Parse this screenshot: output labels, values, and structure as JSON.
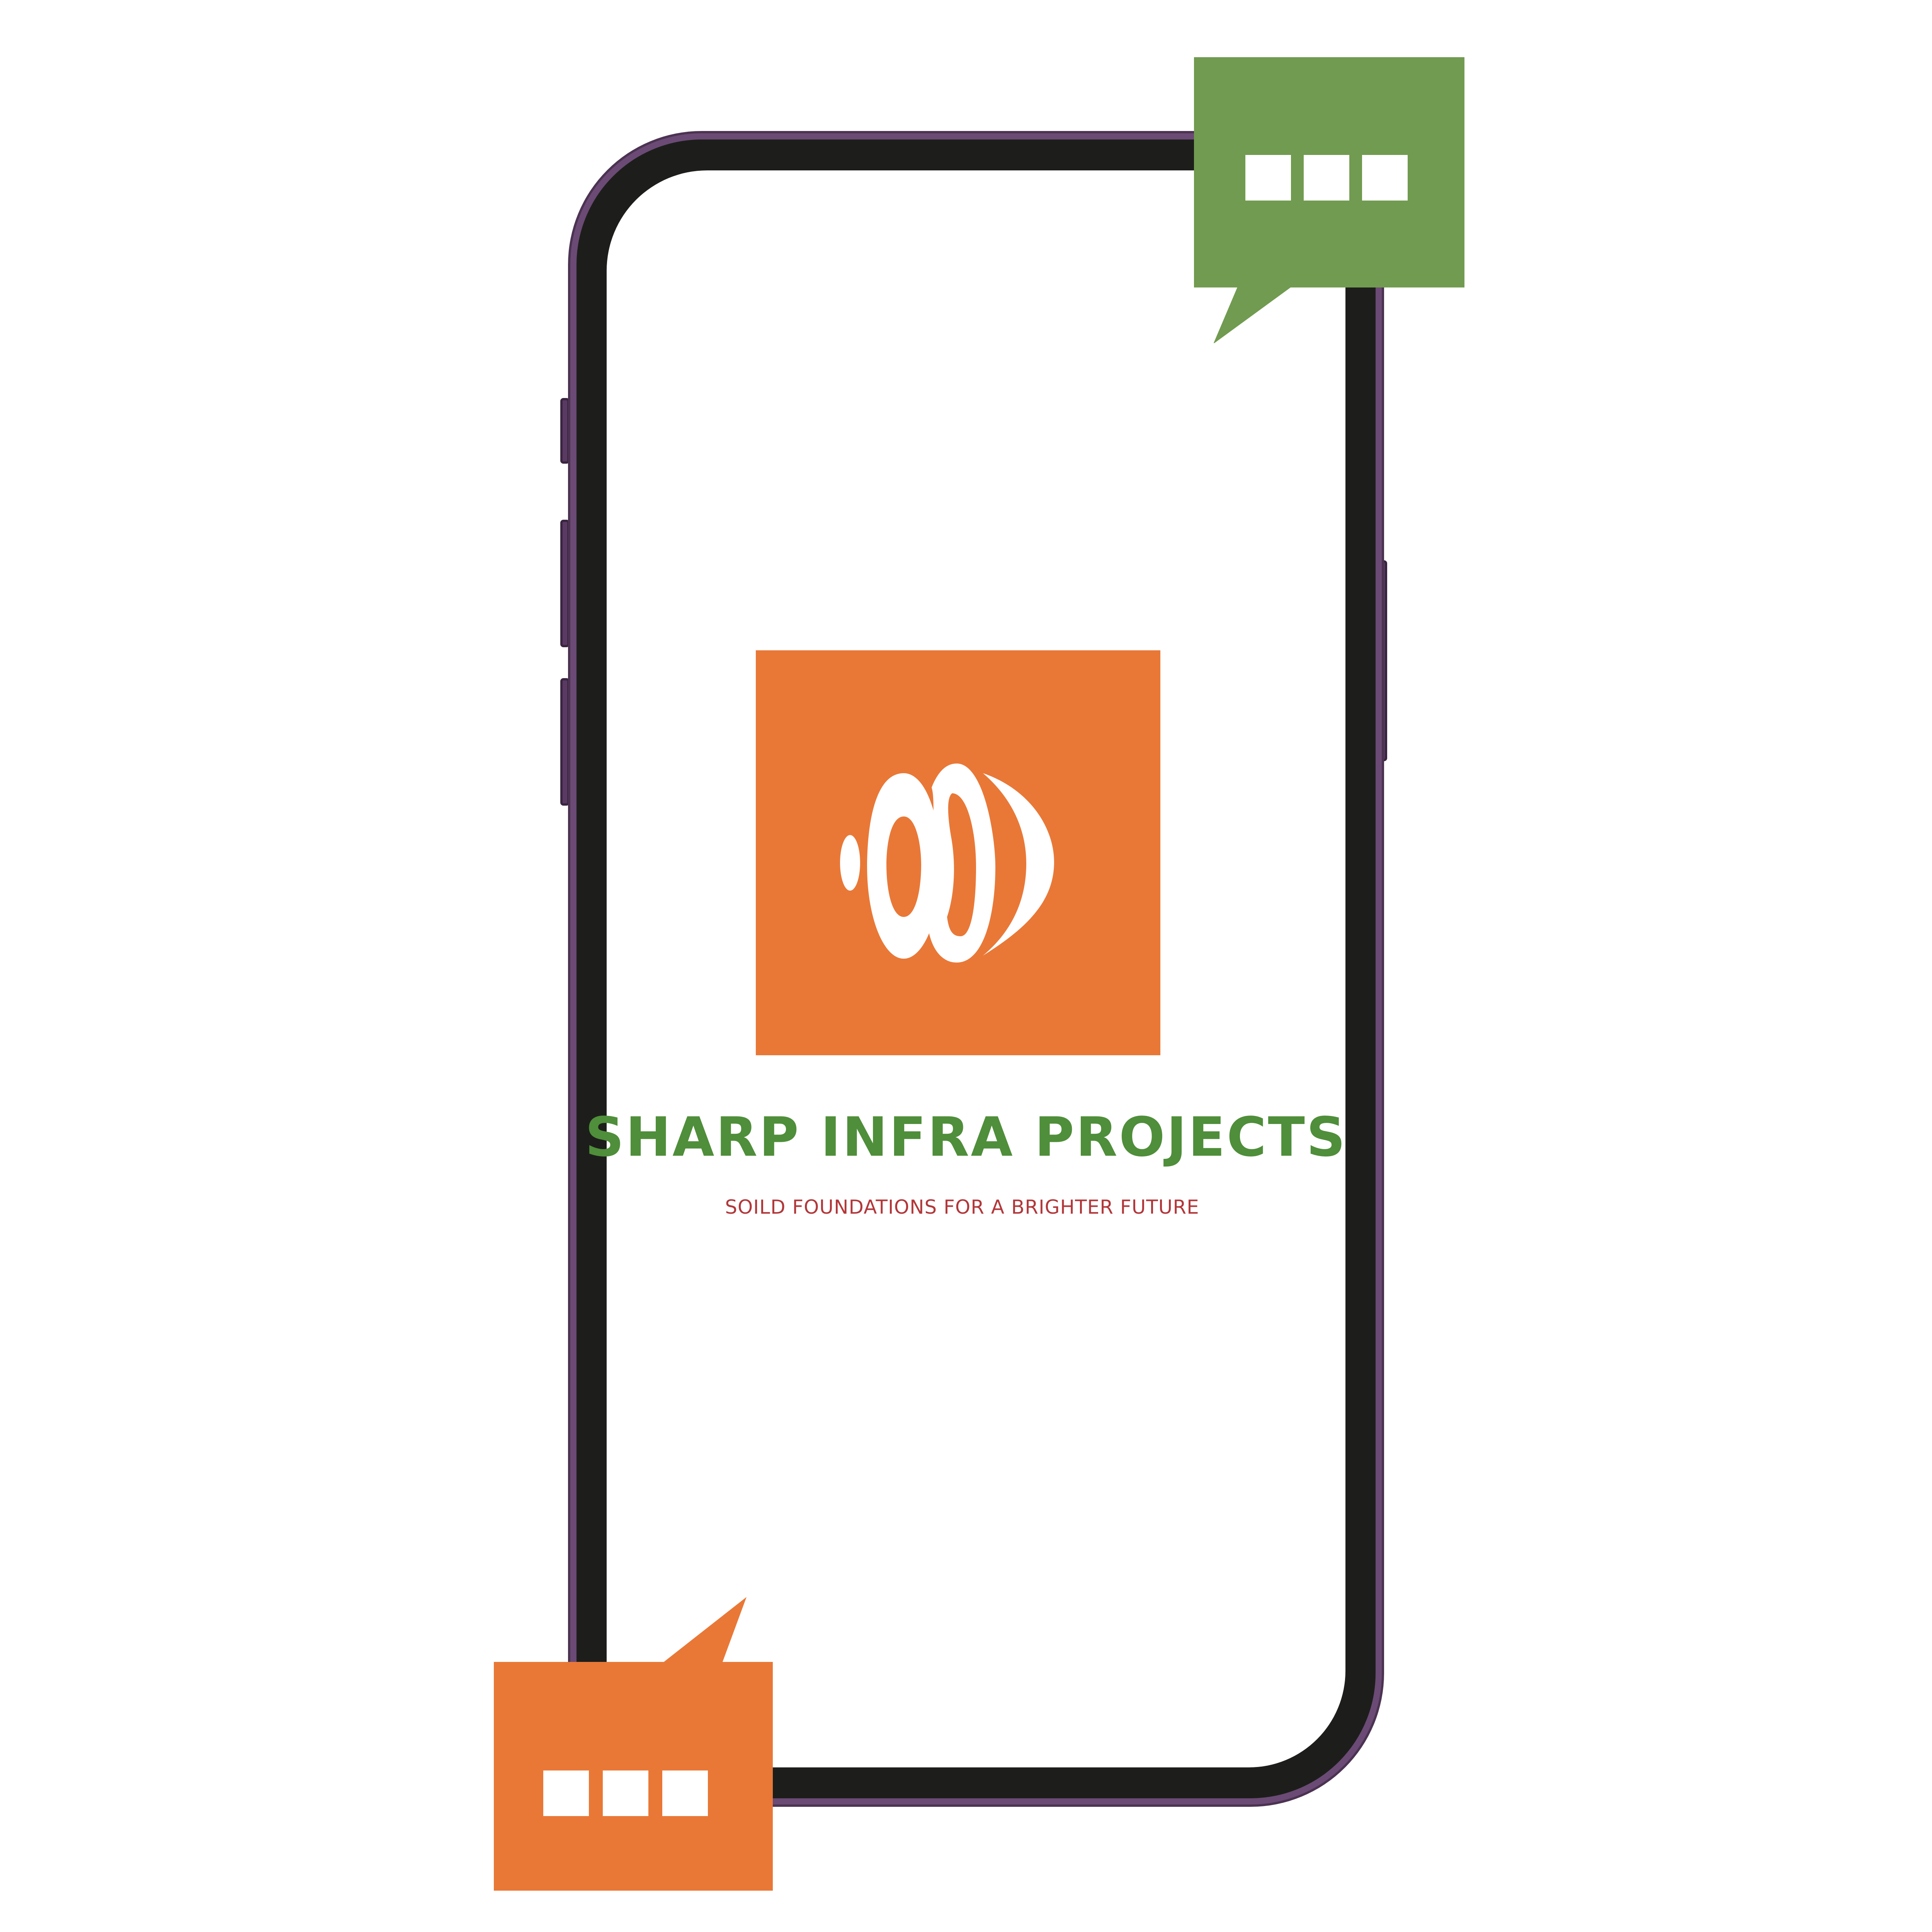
{
  "brand": {
    "name": "SHARP INFRA PROJECTS",
    "tagline": "SOILD FOUNDATIONS FOR A BRIGHTER FUTURE"
  },
  "icons": {
    "logo": "sharp-infra-logo-icon",
    "bubble_top": "chat-bubble-icon",
    "bubble_bottom": "chat-bubble-icon"
  },
  "colors": {
    "brand_orange": "#e97837",
    "brand_green": "#4f8e3a",
    "bubble_green": "#719b50",
    "tagline_red": "#b2373a",
    "phone_body": "#1d1e1b",
    "phone_frame": "#6b4a75"
  }
}
